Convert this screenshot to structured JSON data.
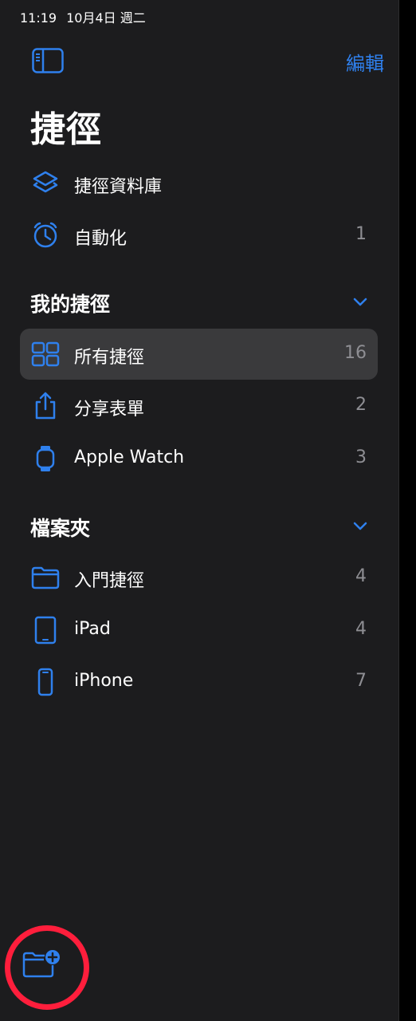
{
  "status_bar": {
    "time": "11:19",
    "date": "10月4日 週二"
  },
  "header": {
    "edit_label": "編輯",
    "title": "捷徑"
  },
  "top_items": [
    {
      "label": "捷徑資料庫",
      "count": "",
      "icon": "layers-icon"
    },
    {
      "label": "自動化",
      "count": "1",
      "icon": "clock-icon"
    }
  ],
  "my_shortcuts": {
    "title": "我的捷徑",
    "items": [
      {
        "label": "所有捷徑",
        "count": "16",
        "icon": "grid-icon",
        "selected": true
      },
      {
        "label": "分享表單",
        "count": "2",
        "icon": "share-icon"
      },
      {
        "label": "Apple Watch",
        "count": "3",
        "icon": "watch-icon"
      }
    ]
  },
  "folders": {
    "title": "檔案夾",
    "items": [
      {
        "label": "入門捷徑",
        "count": "4",
        "icon": "folder-icon"
      },
      {
        "label": "iPad",
        "count": "4",
        "icon": "ipad-icon"
      },
      {
        "label": "iPhone",
        "count": "7",
        "icon": "iphone-icon"
      }
    ]
  },
  "bottom": {
    "icon": "new-folder-icon"
  },
  "colors": {
    "accent": "#2f80ed",
    "background": "#1c1c1e",
    "selected": "#3a3a3c",
    "secondary_text": "#8e8e93",
    "highlight": "#ff1e3c"
  }
}
